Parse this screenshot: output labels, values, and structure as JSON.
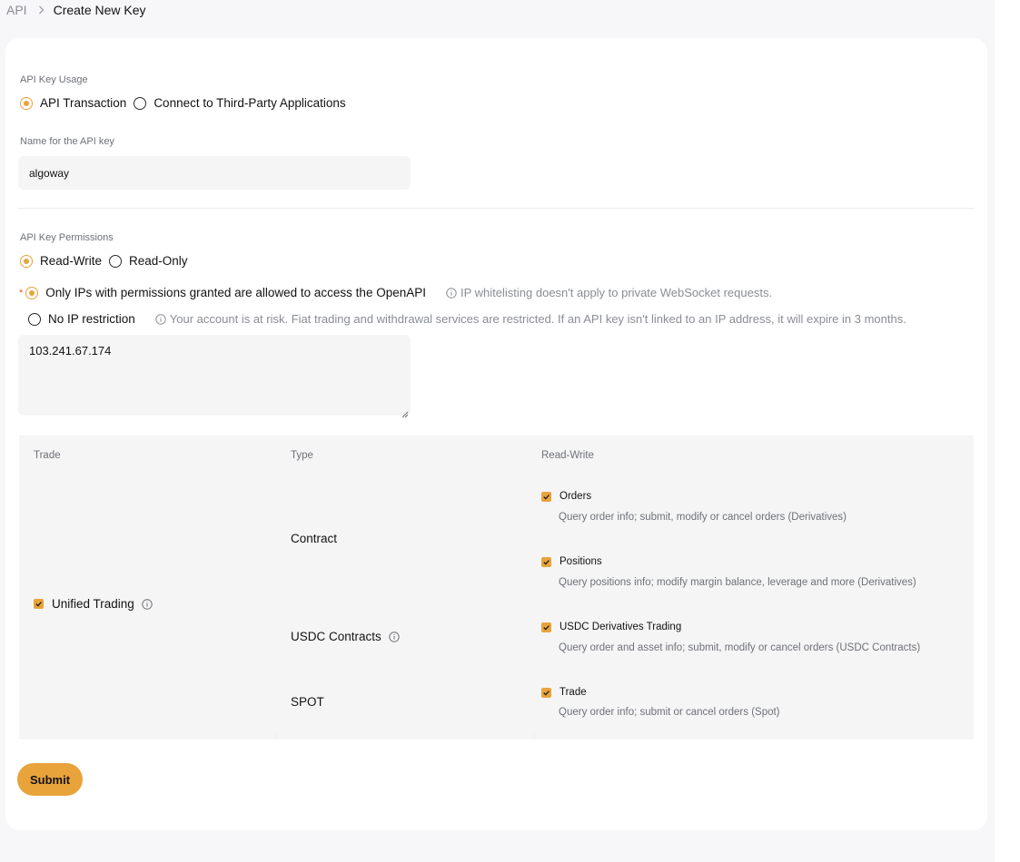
{
  "breadcrumb": {
    "root": "API",
    "current": "Create New Key"
  },
  "usage": {
    "label": "API Key Usage",
    "options": [
      "API Transaction",
      "Connect to Third-Party Applications"
    ],
    "selected": "API Transaction"
  },
  "name_field": {
    "label": "Name for the API key",
    "value": "algoway"
  },
  "permissions": {
    "label": "API Key Permissions",
    "options": [
      "Read-Write",
      "Read-Only"
    ],
    "selected": "Read-Write"
  },
  "ip": {
    "restricted_label": "Only IPs with permissions granted are allowed to access the OpenAPI",
    "restricted_hint": "IP whitelisting doesn't apply to private WebSocket requests.",
    "unrestricted_label": "No IP restriction",
    "unrestricted_hint": "Your account is at risk. Fiat trading and withdrawal services are restricted. If an API key isn't linked to an IP address, it will expire in 3 months.",
    "value": "103.241.67.174",
    "selected": "restricted"
  },
  "table": {
    "headers": {
      "trade": "Trade",
      "type": "Type",
      "rw": "Read-Write"
    },
    "trade_label": "Unified Trading",
    "types": {
      "contract": "Contract",
      "usdc": "USDC Contracts",
      "spot": "SPOT"
    },
    "perms": [
      {
        "title": "Orders",
        "desc": "Query order info; submit, modify or cancel orders (Derivatives)",
        "checked": true
      },
      {
        "title": "Positions",
        "desc": "Query positions info; modify margin balance, leverage and more (Derivatives)",
        "checked": true
      },
      {
        "title": "USDC Derivatives Trading",
        "desc": "Query order and asset info; submit, modify or cancel orders (USDC Contracts)",
        "checked": true
      },
      {
        "title": "Trade",
        "desc": "Query order info; submit or cancel orders (Spot)",
        "checked": true
      }
    ]
  },
  "submit_label": "Submit",
  "colors": {
    "accent": "#e8a33b",
    "required": "#e8553b",
    "muted": "#6e7178"
  },
  "icons": [
    "chevron-right-icon",
    "info-icon",
    "check-icon",
    "resize-grip-icon"
  ]
}
